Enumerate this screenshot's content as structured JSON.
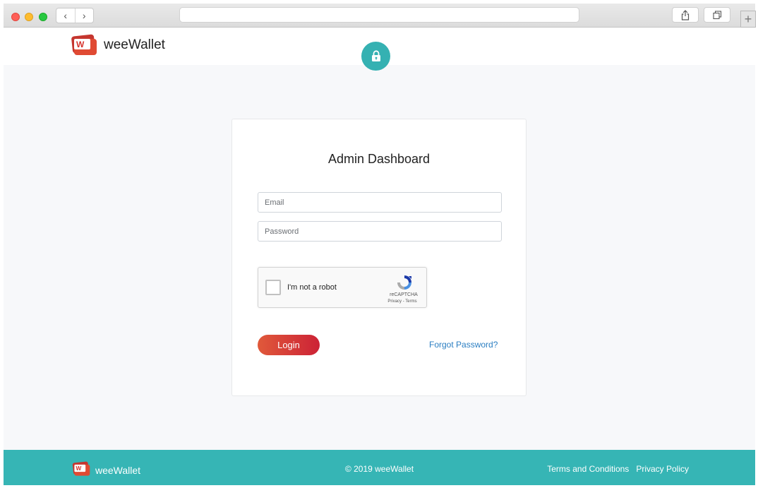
{
  "browser": {
    "back_icon": "‹",
    "forward_icon": "›",
    "new_tab_icon": "+"
  },
  "header": {
    "brand": "weeWallet"
  },
  "login": {
    "title": "Admin Dashboard",
    "email_placeholder": "Email",
    "password_placeholder": "Password",
    "submit_label": "Login",
    "forgot_label": "Forgot Password?"
  },
  "recaptcha": {
    "label": "I'm not a robot",
    "brand": "reCAPTCHA",
    "links": "Privacy - Terms"
  },
  "footer": {
    "brand": "weeWallet",
    "copyright": "© 2019 weeWallet",
    "links": [
      "Terms and Conditions",
      "Privacy Policy"
    ]
  },
  "colors": {
    "accent_teal": "#35b1b2",
    "login_gradient_start": "#e0593a",
    "login_gradient_end": "#cc2236",
    "link_blue": "#2a7ec2"
  },
  "icons": [
    "lock-icon",
    "share-icon",
    "tabs-icon",
    "recaptcha-logo-icon",
    "weewallet-logo-icon"
  ]
}
